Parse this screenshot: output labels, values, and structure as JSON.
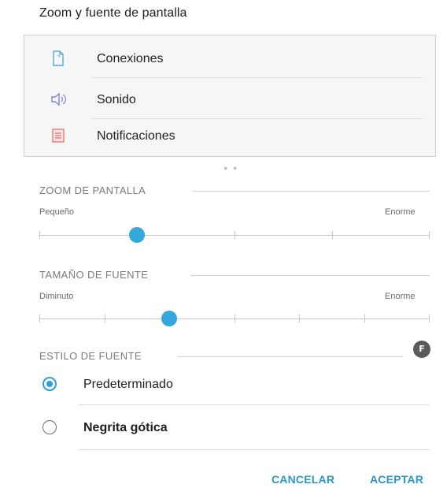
{
  "dialog": {
    "title": "Zoom y fuente de pantalla"
  },
  "preview": {
    "items": [
      {
        "label": "Conexiones",
        "icon": "connections-doc-icon"
      },
      {
        "label": "Sonido",
        "icon": "speaker-icon"
      },
      {
        "label": "Notificaciones",
        "icon": "notifications-list-icon"
      }
    ]
  },
  "screen_zoom": {
    "title": "ZOOM DE PANTALLA",
    "min_label": "Pequeño",
    "max_label": "Enorme",
    "steps": 4,
    "selected_index": 1
  },
  "font_size": {
    "title": "TAMAÑO DE FUENTE",
    "min_label": "Diminuto",
    "max_label": "Enorme",
    "steps": 7,
    "selected_index": 2
  },
  "font_style": {
    "title": "ESTILO DE FUENTE",
    "options": [
      {
        "label": "Predeterminado",
        "selected": true
      },
      {
        "label": "Negrita gótica",
        "selected": false
      }
    ]
  },
  "actions": {
    "cancel": "CANCELAR",
    "accept": "ACEPTAR"
  },
  "colors": {
    "accent": "#34a7dc",
    "action_text": "#2a97c9"
  }
}
